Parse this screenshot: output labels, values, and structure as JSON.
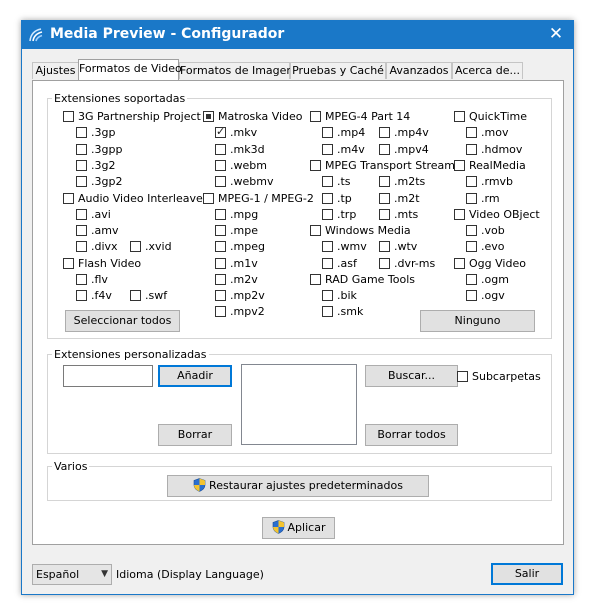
{
  "window": {
    "title": "Media Preview - Configurador",
    "close_symbol": "✕",
    "accent": "#1a78c8"
  },
  "tabs": [
    "Ajustes",
    "Formatos de Video",
    "Formatos de Imagen",
    "Pruebas y Caché",
    "Avanzados",
    "Acerca de..."
  ],
  "active_tab": "Formatos de Video",
  "supported": {
    "label": "Extensiones soportadas",
    "groups": [
      {
        "label": "3G Partnership Project",
        "state": "unchecked",
        "items": [
          ".3gp",
          ".3gpp",
          ".3g2",
          ".3gp2"
        ]
      },
      {
        "label": "Audio Video Interleaved",
        "state": "unchecked",
        "items": [
          ".avi",
          ".amv",
          ".divx",
          ".xvid"
        ]
      },
      {
        "label": "Flash Video",
        "state": "unchecked",
        "items": [
          ".flv",
          ".f4v",
          ".swf"
        ]
      },
      {
        "label": "Matroska Video",
        "state": "indeterminate",
        "items": [
          ".mkv",
          ".mk3d",
          ".webm",
          ".webmv"
        ],
        "checked_items": [
          ".mkv"
        ]
      },
      {
        "label": "MPEG-1 / MPEG-2",
        "state": "unchecked",
        "items": [
          ".mpg",
          ".mpe",
          ".mpeg",
          ".m1v",
          ".m2v",
          ".mp2v",
          ".mpv2"
        ]
      },
      {
        "label": "MPEG-4 Part 14",
        "state": "unchecked",
        "items": [
          ".mp4",
          ".mp4v",
          ".m4v",
          ".mpv4"
        ]
      },
      {
        "label": "MPEG Transport Stream",
        "state": "unchecked",
        "items": [
          ".ts",
          ".m2ts",
          ".tp",
          ".m2t",
          ".trp",
          ".mts"
        ]
      },
      {
        "label": "Windows Media",
        "state": "unchecked",
        "items": [
          ".wmv",
          ".wtv",
          ".asf",
          ".dvr-ms"
        ]
      },
      {
        "label": "RAD Game Tools",
        "state": "unchecked",
        "items": [
          ".bik",
          ".smk"
        ]
      },
      {
        "label": "QuickTime",
        "state": "unchecked",
        "items": [
          ".mov",
          ".hdmov"
        ]
      },
      {
        "label": "RealMedia",
        "state": "unchecked",
        "items": [
          ".rmvb",
          ".rm"
        ]
      },
      {
        "label": "Video OBject",
        "state": "unchecked",
        "items": [
          ".vob",
          ".evo"
        ]
      },
      {
        "label": "Ogg Video",
        "state": "unchecked",
        "items": [
          ".ogm",
          ".ogv"
        ]
      }
    ],
    "select_all_label": "Seleccionar todos",
    "none_label": "Ninguno"
  },
  "custom": {
    "label": "Extensiones personalizadas",
    "input_value": "",
    "add_label": "Añadir",
    "remove_label": "Borrar",
    "browse_label": "Buscar...",
    "subfolders_label": "Subcarpetas",
    "remove_all_label": "Borrar todos"
  },
  "misc": {
    "label": "Varios",
    "restore_label": "Restaurar ajustes predeterminados"
  },
  "apply_label": "Aplicar",
  "footer": {
    "language_value": "Español",
    "language_label": "Idioma (Display Language)",
    "exit_label": "Salir"
  }
}
